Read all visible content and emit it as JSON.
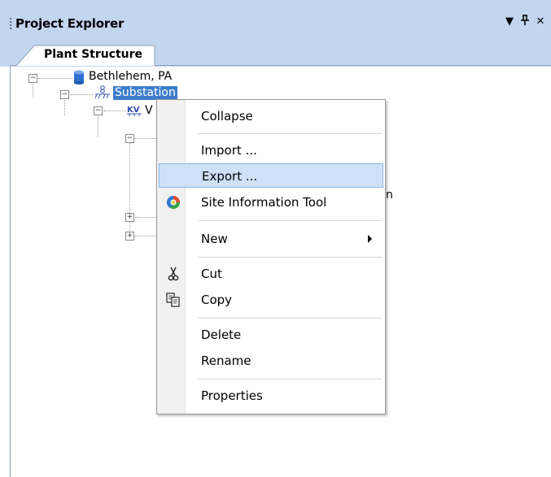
{
  "panel": {
    "title": "Project Explorer",
    "buttons": {
      "dropdown": "▼",
      "pin": "ᵼ",
      "close": "✕"
    }
  },
  "tabs": [
    {
      "label": "Plant Structure"
    }
  ],
  "tree": {
    "root": {
      "label": "Bethlehem, PA",
      "icon": "database-icon"
    },
    "child": {
      "label": "Substation",
      "icon": "substation-icon"
    },
    "grandchild_fragment": "V",
    "behind_menu_fragment": "n"
  },
  "context_menu": {
    "items": [
      {
        "label": "Collapse"
      },
      {
        "label": "Import ..."
      },
      {
        "label": "Export ...",
        "highlighted": true
      },
      {
        "label": "Site Information Tool",
        "icon": "site-info-icon"
      },
      {
        "label": "New",
        "submenu": true
      },
      {
        "label": "Cut",
        "icon": "scissors-icon"
      },
      {
        "label": "Copy",
        "icon": "copy-icon"
      },
      {
        "label": "Delete"
      },
      {
        "label": "Rename"
      },
      {
        "label": "Properties"
      }
    ]
  },
  "colors": {
    "header_bg": "#c3d6ef",
    "selection": "#3d7dca",
    "menu_highlight": "#cfe1f7",
    "menu_highlight_border": "#8eb6e6"
  }
}
